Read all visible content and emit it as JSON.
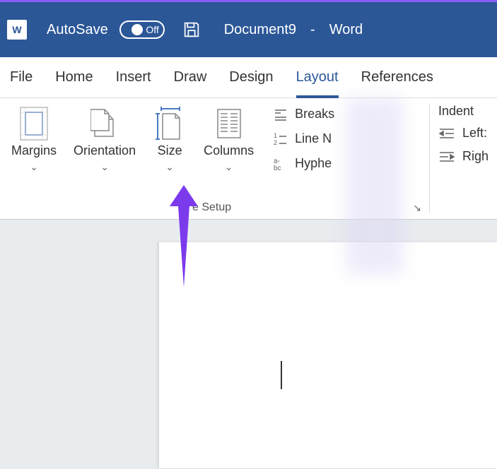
{
  "titlebar": {
    "autosave_label": "AutoSave",
    "autosave_state": "Off",
    "document_name": "Document9",
    "separator": "-",
    "app_name": "Word"
  },
  "tabs": {
    "items": [
      {
        "label": "File"
      },
      {
        "label": "Home"
      },
      {
        "label": "Insert"
      },
      {
        "label": "Draw"
      },
      {
        "label": "Design"
      },
      {
        "label": "Layout"
      },
      {
        "label": "References"
      }
    ],
    "active_index": 5
  },
  "ribbon": {
    "page_setup": {
      "margins_label": "Margins",
      "orientation_label": "Orientation",
      "size_label": "Size",
      "columns_label": "Columns",
      "breaks_label": "Breaks",
      "line_numbers_label": "Line N",
      "hyphenation_label": "Hyphe",
      "group_name": "e Setup"
    },
    "indent": {
      "header": "Indent",
      "left_label": "Left:",
      "right_label": "Righ"
    }
  }
}
